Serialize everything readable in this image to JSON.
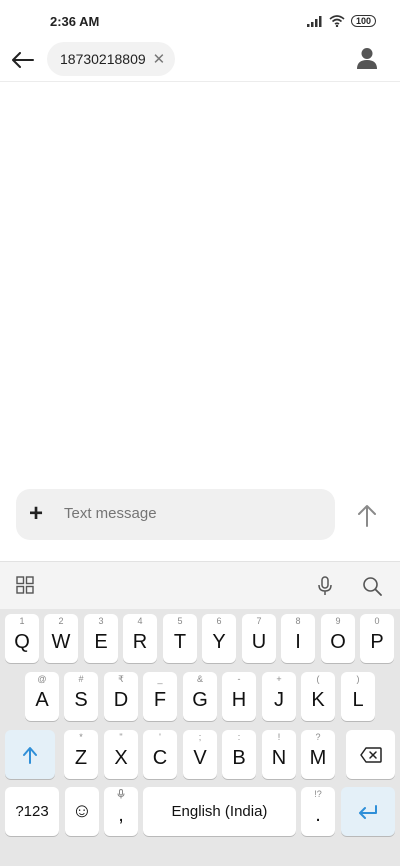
{
  "status": {
    "time": "2:36 AM",
    "battery": "100"
  },
  "header": {
    "recipient": "18730218809",
    "chip_close": "✕"
  },
  "composer": {
    "placeholder": "Text message",
    "plus": "+"
  },
  "keyboard": {
    "row1": [
      {
        "hint": "1",
        "label": "Q"
      },
      {
        "hint": "2",
        "label": "W"
      },
      {
        "hint": "3",
        "label": "E"
      },
      {
        "hint": "4",
        "label": "R"
      },
      {
        "hint": "5",
        "label": "T"
      },
      {
        "hint": "6",
        "label": "Y"
      },
      {
        "hint": "7",
        "label": "U"
      },
      {
        "hint": "8",
        "label": "I"
      },
      {
        "hint": "9",
        "label": "O"
      },
      {
        "hint": "0",
        "label": "P"
      }
    ],
    "row2": [
      {
        "hint": "@",
        "label": "A"
      },
      {
        "hint": "#",
        "label": "S"
      },
      {
        "hint": "₹",
        "label": "D"
      },
      {
        "hint": "_",
        "label": "F"
      },
      {
        "hint": "&",
        "label": "G"
      },
      {
        "hint": "-",
        "label": "H"
      },
      {
        "hint": "+",
        "label": "J"
      },
      {
        "hint": "(",
        "label": "K"
      },
      {
        "hint": ")",
        "label": "L"
      }
    ],
    "row3": [
      {
        "hint": "*",
        "label": "Z"
      },
      {
        "hint": "\"",
        "label": "X"
      },
      {
        "hint": "'",
        "label": "C"
      },
      {
        "hint": ";",
        "label": "V"
      },
      {
        "hint": ":",
        "label": "B"
      },
      {
        "hint": "!",
        "label": "N"
      },
      {
        "hint": "?",
        "label": "M"
      }
    ],
    "symbols_label": "?123",
    "emoji_label": "☺",
    "comma_label": ",",
    "space_label": "English (India)",
    "period_hint": "!?",
    "period_label": ".",
    "accent_color": "#2f8fd8"
  }
}
